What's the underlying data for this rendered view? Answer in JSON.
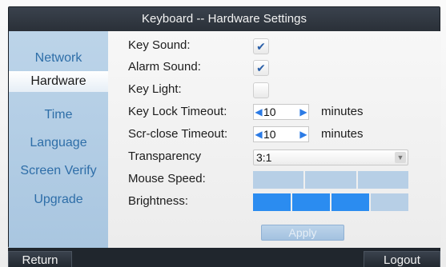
{
  "window": {
    "title": "Keyboard -- Hardware Settings"
  },
  "sidebar": {
    "items": [
      {
        "label": "Network",
        "active": false
      },
      {
        "label": "Hardware",
        "active": true
      },
      {
        "label": "Time",
        "active": false
      },
      {
        "label": "Language",
        "active": false
      },
      {
        "label": "Screen Verify",
        "active": false
      },
      {
        "label": "Upgrade",
        "active": false
      }
    ]
  },
  "settings": {
    "key_sound": {
      "label": "Key Sound:",
      "checked": true
    },
    "alarm_sound": {
      "label": "Alarm Sound:",
      "checked": true
    },
    "key_light": {
      "label": "Key Light:",
      "checked": false
    },
    "key_lock_timeout": {
      "label": "Key Lock Timeout:",
      "value": "10",
      "unit": "minutes"
    },
    "scr_close_timeout": {
      "label": "Scr-close Timeout:",
      "value": "10",
      "unit": "minutes"
    },
    "transparency": {
      "label": "Transparency",
      "value": "3:1"
    },
    "mouse_speed": {
      "label": "Mouse Speed:",
      "level": 0,
      "segments": 3
    },
    "brightness": {
      "label": "Brightness:",
      "level": 3,
      "segments": 4
    }
  },
  "buttons": {
    "apply": "Apply",
    "return": "Return",
    "logout": "Logout"
  },
  "colors": {
    "accent": "#2c7be5",
    "level_filled": "#2b8cf0",
    "level_empty": "#b7cfe6",
    "sidebar_text": "#2e6ea8"
  }
}
